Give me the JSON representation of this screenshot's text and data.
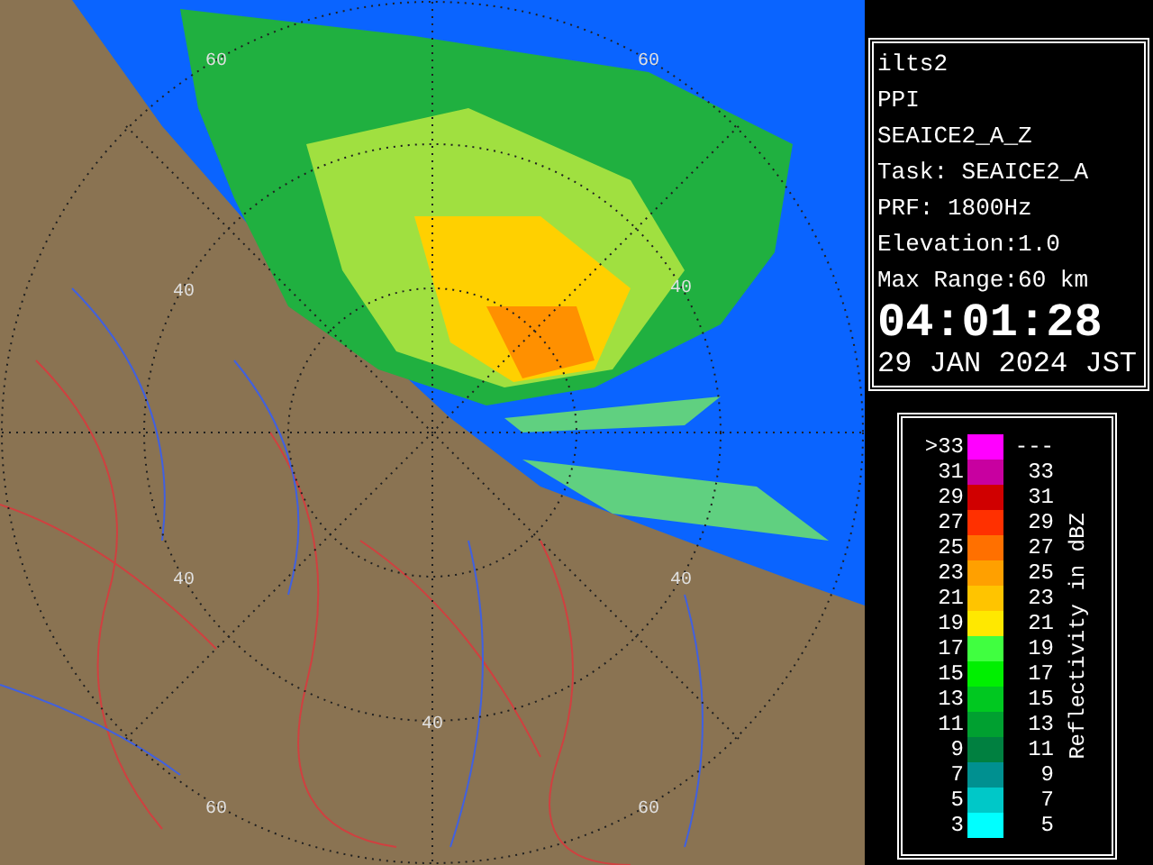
{
  "map": {
    "range_labels": [
      "60",
      "60",
      "40",
      "40",
      "40",
      "40",
      "40",
      "60",
      "60"
    ]
  },
  "info": {
    "lines": [
      "ilts2",
      "PPI",
      "SEAICE2_A_Z",
      "Task: SEAICE2_A",
      "PRF: 1800Hz",
      "Elevation:1.0",
      "Max Range:60 km"
    ],
    "time": "04:01:28",
    "date": "29 JAN 2024 JST"
  },
  "legend": {
    "title": "Reflectivity in dBZ",
    "rows": [
      {
        "low": ">33",
        "high": "---",
        "color": "#ff00ff"
      },
      {
        "low": "31",
        "high": "33",
        "color": "#c800a0"
      },
      {
        "low": "29",
        "high": "31",
        "color": "#d00000"
      },
      {
        "low": "27",
        "high": "29",
        "color": "#ff3000"
      },
      {
        "low": "25",
        "high": "27",
        "color": "#ff7000"
      },
      {
        "low": "23",
        "high": "25",
        "color": "#ffa000"
      },
      {
        "low": "21",
        "high": "23",
        "color": "#ffc400"
      },
      {
        "low": "19",
        "high": "21",
        "color": "#ffe800"
      },
      {
        "low": "17",
        "high": "19",
        "color": "#40ff40"
      },
      {
        "low": "15",
        "high": "17",
        "color": "#00f000"
      },
      {
        "low": "13",
        "high": "15",
        "color": "#00c820"
      },
      {
        "low": "11",
        "high": "13",
        "color": "#00a030"
      },
      {
        "low": "9",
        "high": "11",
        "color": "#008040"
      },
      {
        "low": "7",
        "high": "9",
        "color": "#009090"
      },
      {
        "low": "5",
        "high": "7",
        "color": "#00c8c8"
      },
      {
        "low": "3",
        "high": "5",
        "color": "#00ffff"
      }
    ]
  }
}
